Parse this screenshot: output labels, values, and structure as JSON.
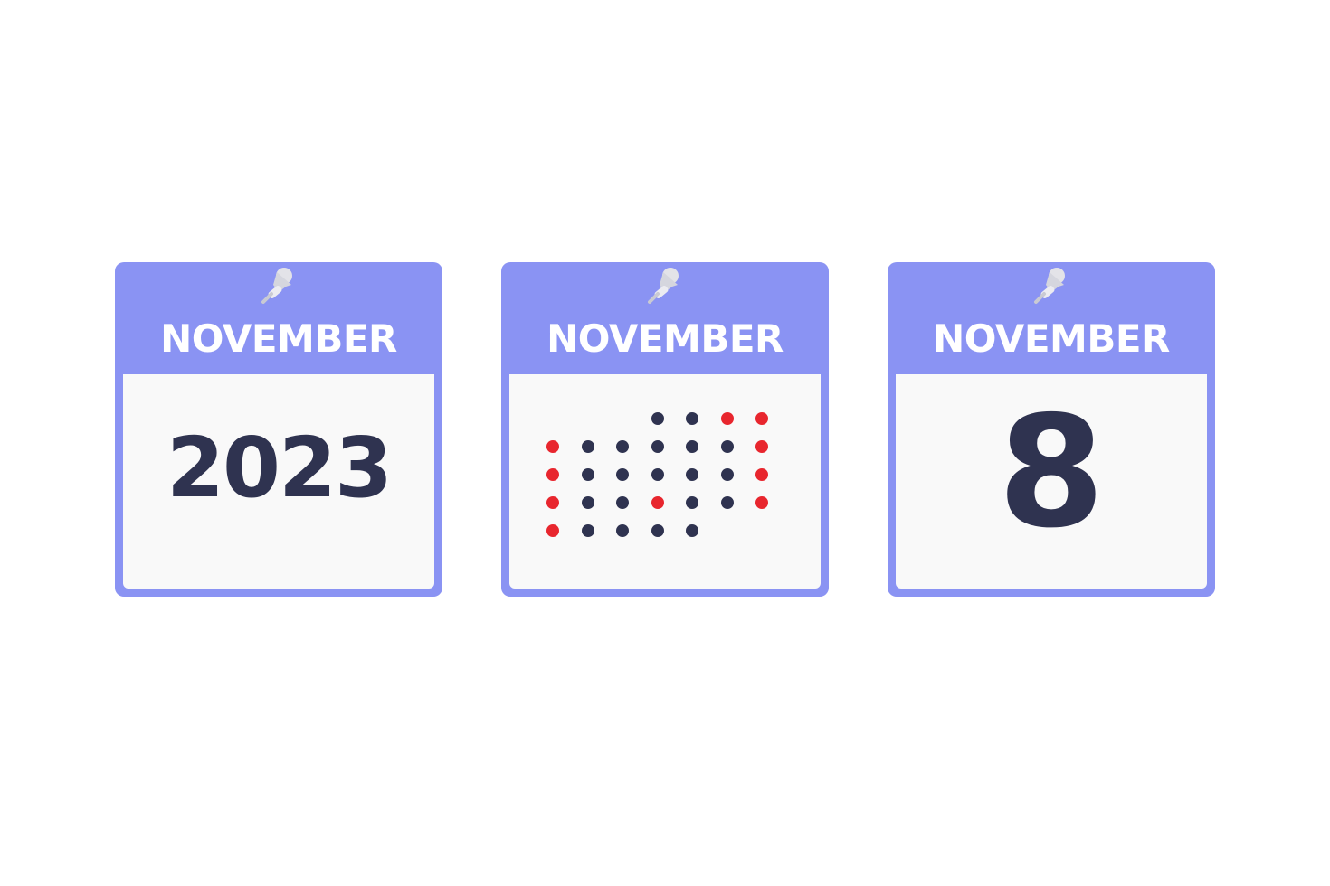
{
  "calendars": [
    {
      "month": "NOVEMBER",
      "value": "2023"
    },
    {
      "month": "NOVEMBER"
    },
    {
      "month": "NOVEMBER",
      "value": "8"
    }
  ],
  "colors": {
    "frame": "#8a93f3",
    "body": "#f9f9f9",
    "text_dark": "#2f3350",
    "dot_dark": "#2f3350",
    "dot_red": "#e8262e",
    "pin": "#e3e3e8"
  },
  "icons": [
    "push-pin-icon"
  ],
  "month_grid": {
    "first_weekday_index": 3,
    "days_in_month": 30,
    "highlight_columns": [
      0,
      6
    ],
    "extra_highlight_days": [
      3,
      22
    ]
  }
}
